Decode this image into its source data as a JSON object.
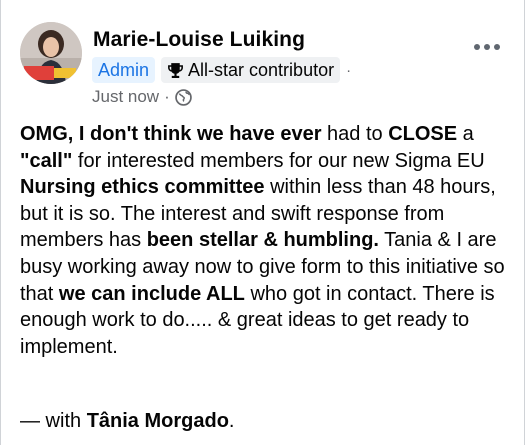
{
  "author": {
    "name": "Marie-Louise Luiking"
  },
  "badges": {
    "role": "Admin",
    "contributor": "All-star contributor",
    "separator": "·"
  },
  "meta": {
    "time": "Just now",
    "separator": "·",
    "audience_icon": "globe-icon"
  },
  "more_menu_icon": "more-horizontal-icon",
  "post": {
    "s1": "OMG, I don't think we have ever",
    "s2": " had to ",
    "s3": "CLOSE",
    "s4": " a ",
    "s5": "\"call\"",
    "s6": " for interested members for our new Sigma EU ",
    "s7": "Nursing ethics committee",
    "s8": " within less than 48 hours, but it is so. The interest and swift response from members has ",
    "s9": "been stellar & humbling.",
    "s10": " Tania & I are busy working away now to give form to this initiative so that ",
    "s11": "we can include ALL",
    "s12": " who got in contact. There is enough work to do..... & great ideas to get ready to implement."
  },
  "tagline": {
    "prefix": "— with ",
    "person": "Tânia Morgado",
    "suffix": "."
  },
  "colors": {
    "accent": "#1b74e4",
    "badge_bg": "#e7f3ff",
    "muted": "#65676b"
  }
}
